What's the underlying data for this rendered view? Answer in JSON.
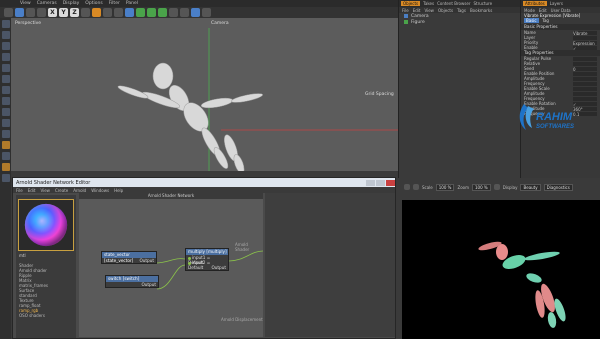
{
  "menubar": [
    "File",
    "Edit",
    "View",
    "Objects",
    "Tags",
    "Bookmarks"
  ],
  "toolbar": {
    "undo": "↶",
    "x_label": "X",
    "y_label": "Y",
    "z_label": "Z"
  },
  "viewport": {
    "menu": [
      "View",
      "Cameras",
      "Display",
      "Options",
      "Filter",
      "Panel"
    ],
    "label_perspective": "Perspective",
    "label_default_camera": "Default Camera",
    "label_camera": "Camera",
    "label_grid_spacing": "Grid Spacing"
  },
  "object_manager": {
    "tabs": [
      "Objects",
      "Takes",
      "Content Browser",
      "Structure"
    ],
    "active_tab": "Objects",
    "menu": [
      "File",
      "Edit",
      "View",
      "Objects",
      "Tags",
      "Bookmarks"
    ],
    "rows": [
      "Camera",
      "Figure"
    ]
  },
  "attributes": {
    "tabs": [
      "Attributes",
      "Layers"
    ],
    "menu": [
      "Mode",
      "Edit",
      "User Data"
    ],
    "title": "Vibrate Expression [Vibrate]",
    "subtabs": [
      "Basic",
      "Tag"
    ],
    "active_subtab": "Basic",
    "basic_title": "Basic Properties",
    "basic_rows": [
      {
        "label": "Name",
        "value": "Vibrate"
      },
      {
        "label": "Layer",
        "value": ""
      },
      {
        "label": "Priority",
        "value": "Expression"
      },
      {
        "label": "Enable",
        "value": "✓"
      }
    ],
    "tag_title": "Tag Properties",
    "tag_rows": [
      {
        "label": "Regular Pulse",
        "value": ""
      },
      {
        "label": "Relative",
        "value": ""
      },
      {
        "label": "Seed",
        "value": "0"
      },
      {
        "label": "Enable Position",
        "value": ""
      },
      {
        "label": "Amplitude",
        "value": ""
      },
      {
        "label": "Frequency",
        "value": ""
      },
      {
        "label": "Enable Scale",
        "value": ""
      },
      {
        "label": "Amplitude",
        "value": ""
      },
      {
        "label": "Frequency",
        "value": ""
      },
      {
        "label": "Enable Rotation",
        "value": "✓"
      },
      {
        "label": "Amplitude",
        "value": "360°"
      },
      {
        "label": "Frequency",
        "value": "0.1"
      }
    ]
  },
  "logo": {
    "line1": "RAHIM",
    "line2": "SOFTWARES",
    "color": "#1e73c8"
  },
  "render_view": {
    "scale_label": "Scale",
    "scale_value": "100 %",
    "zoom_label": "Zoom",
    "zoom_value": "100 %",
    "display_label": "Display",
    "display_value": "Beauty",
    "diag_label": "Diagnostics"
  },
  "shader_editor": {
    "title": "Arnold Shader Network Editor",
    "menu": [
      "File",
      "Edit",
      "View",
      "Create",
      "Arnold",
      "Windows",
      "Help"
    ],
    "canvas_title": "Arnold Shader Network",
    "material_name": "mtl",
    "tree": [
      {
        "label": "Shader",
        "hl": false
      },
      {
        "label": "Arnold shader",
        "hl": false
      },
      {
        "label": "Ripple",
        "hl": false
      },
      {
        "label": "Matrix",
        "hl": false
      },
      {
        "label": "matrix_frames",
        "hl": false
      },
      {
        "label": "Surface",
        "hl": false
      },
      {
        "label": "standard",
        "hl": false
      },
      {
        "label": "Texture",
        "hl": false
      },
      {
        "label": "ramp_float",
        "hl": false
      },
      {
        "label": "ramp_rgb",
        "hl": true
      },
      {
        "label": "OSO shaders",
        "hl": false
      }
    ],
    "nodes": {
      "state_vector": {
        "title": "state_vector [state_vector]",
        "port": "Output"
      },
      "switch": {
        "title": "switch [switch]",
        "port": "Output"
      },
      "multiply": {
        "title": "multiply [multiply]",
        "ports": [
          "input1 = Default",
          "input2 = Default"
        ],
        "out": "Output"
      },
      "arnold_shader_label": "Arnold Shader",
      "arnold_displacement_label": "Arnold Displacement"
    }
  }
}
